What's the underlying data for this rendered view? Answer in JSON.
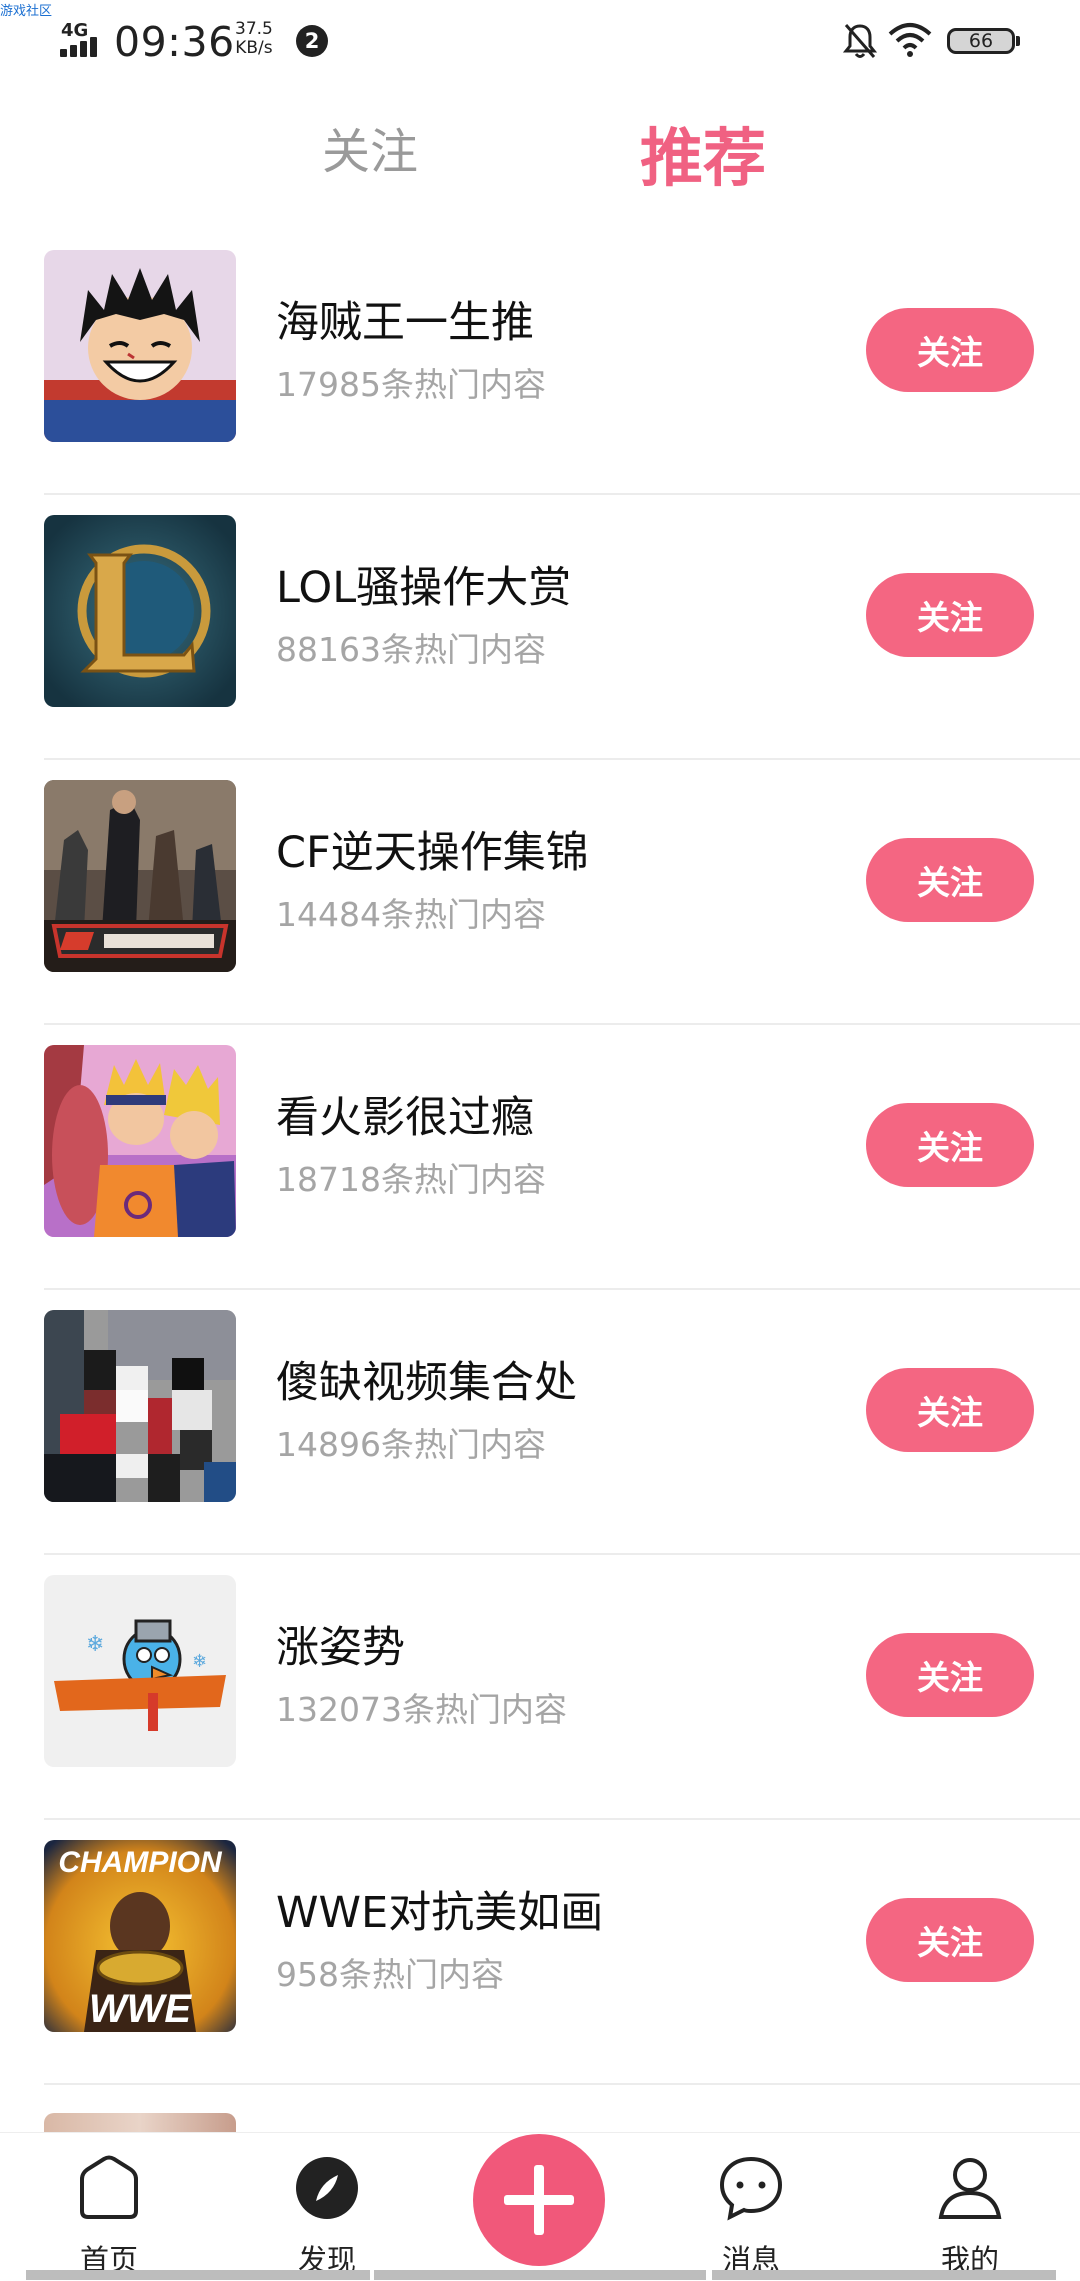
{
  "watermark": "游戏社区",
  "status_bar": {
    "network": "4G",
    "time": "09:36",
    "speed_value": "37.5",
    "speed_unit": "KB/s",
    "notification_count": "2",
    "battery": "66"
  },
  "tabs": {
    "follow": "关注",
    "recommend": "推荐",
    "active": "recommend"
  },
  "colors": {
    "accent": "#f06182",
    "button": "#f46682"
  },
  "items": [
    {
      "title": "海贼王一生推",
      "count": "17985条热门内容",
      "button": "关注",
      "thumb": "one-piece-luffy-avatar"
    },
    {
      "title": "LOL骚操作大赏",
      "count": "88163条热门内容",
      "button": "关注",
      "thumb": "league-of-legends-logo"
    },
    {
      "title": "CF逆天操作集锦",
      "count": "14484条热门内容",
      "button": "关注",
      "thumb": "crossfire-game-art"
    },
    {
      "title": "看火影很过瘾",
      "count": "18718条热门内容",
      "button": "关注",
      "thumb": "naruto-characters-art"
    },
    {
      "title": "傻缺视频集合处",
      "count": "14896条热门内容",
      "button": "关注",
      "thumb": "pixelated-photo"
    },
    {
      "title": "涨姿势",
      "count": "132073条热门内容",
      "button": "关注",
      "thumb": "zhang-zhi-shi-logo"
    },
    {
      "title": "WWE对抗美如画",
      "count": "958条热门内容",
      "button": "关注",
      "thumb": "wwe-champion-poster",
      "thumb_text_top": "CHAMPION",
      "thumb_text_bottom": "WWE"
    }
  ],
  "bottom_nav": {
    "home": "首页",
    "discover": "发现",
    "messages": "消息",
    "me": "我的"
  }
}
